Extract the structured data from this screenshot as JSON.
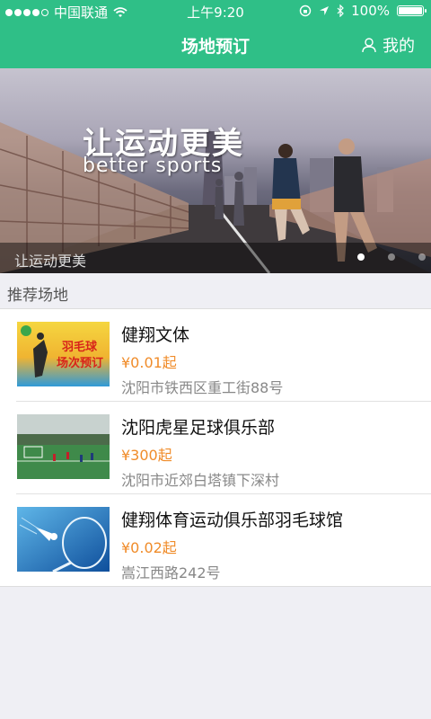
{
  "status": {
    "carrier": "中国联通",
    "time": "上午9:20",
    "battery": "100%"
  },
  "nav": {
    "title": "场地预订",
    "mine_label": "我的"
  },
  "banner": {
    "slogan": "让运动更美",
    "slogan_en": "better sports",
    "caption": "让运动更美",
    "pages": 3,
    "active_page": 1
  },
  "section": {
    "title": "推荐场地"
  },
  "venues": [
    {
      "name": "健翔文体",
      "price": "¥0.01起",
      "address": "沈阳市铁西区重工街88号",
      "thumb_text": "羽毛球 场次预订"
    },
    {
      "name": "沈阳虎星足球俱乐部",
      "price": "¥300起",
      "address": "沈阳市近郊白塔镇下深村"
    },
    {
      "name": "健翔体育运动俱乐部羽毛球馆",
      "price": "¥0.02起",
      "address": "嵩江西路242号"
    }
  ],
  "colors": {
    "brand": "#2fbf87",
    "price": "#f08c2a"
  }
}
